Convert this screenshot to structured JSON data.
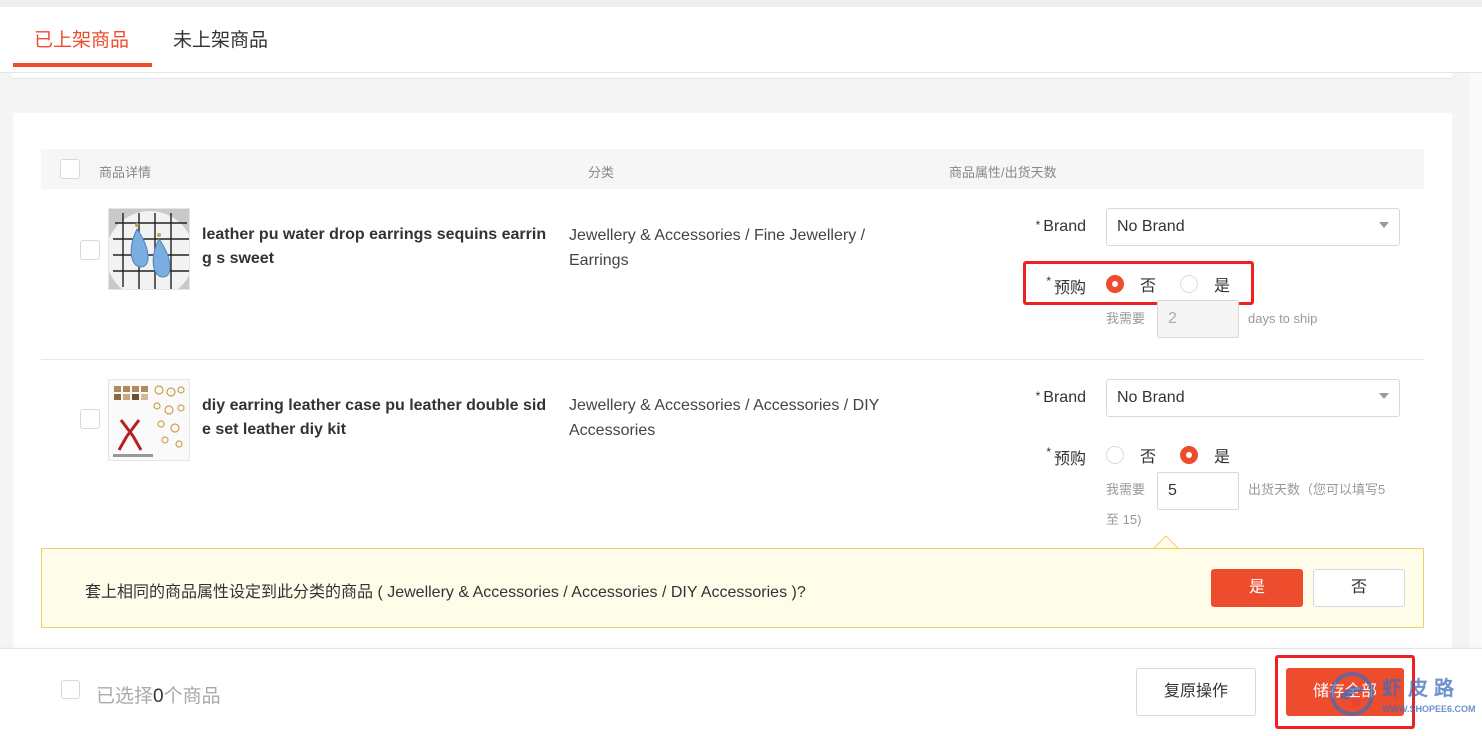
{
  "tabs": [
    {
      "label": "已上架商品",
      "active": true
    },
    {
      "label": "未上架商品",
      "active": false
    }
  ],
  "table_header": {
    "product_details": "商品详情",
    "category": "分类",
    "attributes": "商品属性/出货天数"
  },
  "products": [
    {
      "name": "leather pu water drop earrings sequins earring s sweet",
      "category": "Jewellery & Accessories / Fine Jewellery / Earrings",
      "brand_label": "Brand",
      "brand_value": "No Brand",
      "preorder_label": "预购",
      "option_no": "否",
      "option_yes": "是",
      "preorder_selected": "no",
      "need_label": "我需要",
      "days_value": "2",
      "days_hint": "days to ship"
    },
    {
      "name": "diy earring leather case pu leather double side set leather diy kit",
      "category": "Jewellery & Accessories / Accessories / DIY Accessories",
      "brand_label": "Brand",
      "brand_value": "No Brand",
      "preorder_label": "预购",
      "option_no": "否",
      "option_yes": "是",
      "preorder_selected": "yes",
      "need_label": "我需要",
      "days_value": "5",
      "days_hint_line1": "出货天数（您可以填写5",
      "days_hint_line2": "至 15)"
    }
  ],
  "banner": {
    "text": "套上相同的商品属性设定到此分类的商品 ( Jewellery & Accessories / Accessories / DIY Accessories )?",
    "yes_label": "是",
    "no_label": "否"
  },
  "footer": {
    "selected_prefix": "已选择",
    "selected_count": "0",
    "selected_suffix": "个商品",
    "reset_label": "复原操作",
    "save_label": "储存全部"
  },
  "watermark": {
    "text": "虾皮路",
    "url": "WWW.SHOPEE6.COM"
  },
  "colors": {
    "accent": "#ee4d2d",
    "highlight_box": "#ee2020",
    "banner_bg": "#fffcea",
    "banner_border": "#f0cf63"
  }
}
